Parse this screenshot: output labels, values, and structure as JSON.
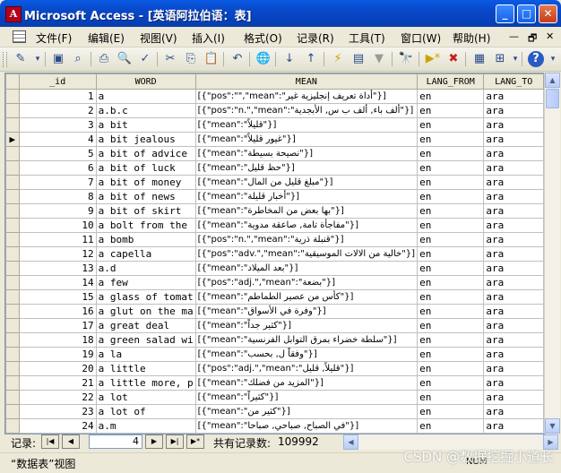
{
  "window": {
    "app_icon": "access-key-icon",
    "title": "Microsoft Access - [英语阿拉伯语：表]",
    "minimize": "_",
    "maximize": "□",
    "close": "✕"
  },
  "menu": {
    "items": [
      "文件(F)",
      "编辑(E)",
      "视图(V)",
      "插入(I)",
      "格式(O)",
      "记录(R)",
      "工具(T)",
      "窗口(W)",
      "帮助(H)"
    ],
    "mdi_min": "—",
    "mdi_restore": "🗗",
    "mdi_close": "✕"
  },
  "toolbar_icons": [
    "view-icon",
    "save-icon",
    "search-db-icon",
    "print-icon",
    "print-preview-icon",
    "spellcheck-icon",
    "cut-icon",
    "copy-icon",
    "paste-icon",
    "undo-icon",
    "hyperlink-icon",
    "sort-asc-icon",
    "sort-desc-icon",
    "filter-by-selection-icon",
    "filter-by-form-icon",
    "apply-filter-icon",
    "find-icon",
    "new-record-icon",
    "delete-record-icon",
    "database-window-icon",
    "new-object-icon",
    "help-icon"
  ],
  "table": {
    "columns": [
      "_id",
      "WORD",
      "MEAN",
      "LANG_FROM",
      "LANG_TO"
    ],
    "current_row_index": 3,
    "rows": [
      {
        "id": "1",
        "word": "a",
        "mean": "[{\"pos\":\"\",\"mean\":\"أداة تعريف إنجليزية غير\"}]",
        "from": "en",
        "to": "ara"
      },
      {
        "id": "2",
        "word": "a.b.c",
        "mean": "[{\"pos\":\"n.\",\"mean\":\"ألف باء, ألف ب س, الأبجدية\"}]",
        "from": "en",
        "to": "ara"
      },
      {
        "id": "3",
        "word": "a bit",
        "mean": "[{\"mean\":\"قليلاً\"}]",
        "from": "en",
        "to": "ara"
      },
      {
        "id": "4",
        "word": "a bit jealous",
        "mean": "[{\"mean\":\"غيور قليلاً\"}]",
        "from": "en",
        "to": "ara"
      },
      {
        "id": "5",
        "word": "a bit of advice",
        "mean": "[{\"mean\":\"نصيحة بسيطة\"}]",
        "from": "en",
        "to": "ara"
      },
      {
        "id": "6",
        "word": "a bit of luck",
        "mean": "[{\"mean\":\"حظ قليل\"}]",
        "from": "en",
        "to": "ara"
      },
      {
        "id": "7",
        "word": "a bit of money",
        "mean": "[{\"mean\":\"مبلغ قليل من المال\"}]",
        "from": "en",
        "to": "ara"
      },
      {
        "id": "8",
        "word": "a bit of news",
        "mean": "[{\"mean\":\"أخبار قليلة\"}]",
        "from": "en",
        "to": "ara"
      },
      {
        "id": "9",
        "word": "a bit of skirt",
        "mean": "[{\"mean\":\"بها بعض من المخاطرة\"}]",
        "from": "en",
        "to": "ara"
      },
      {
        "id": "10",
        "word": "a bolt from the",
        "mean": "[{\"mean\":\"مفاجأة تامة, صاعقة مدوية\"}]",
        "from": "en",
        "to": "ara"
      },
      {
        "id": "11",
        "word": "a bomb",
        "mean": "[{\"pos\":\"n.\",\"mean\":\"قنبلة ذرية\"}]",
        "from": "en",
        "to": "ara"
      },
      {
        "id": "12",
        "word": "a capella",
        "mean": "[{\"pos\":\"adv.\",\"mean\":\"خالية من الالات الموسيقية\"}]",
        "from": "en",
        "to": "ara"
      },
      {
        "id": "13",
        "word": "a.d",
        "mean": "[{\"mean\":\"بعد الميلاد\"}]",
        "from": "en",
        "to": "ara"
      },
      {
        "id": "14",
        "word": "a few",
        "mean": "[{\"pos\":\"adj.\",\"mean\":\"بضعة\"}]",
        "from": "en",
        "to": "ara"
      },
      {
        "id": "15",
        "word": "a glass of tomat",
        "mean": "[{\"mean\":\"كأس من عصير الطماطم\"}]",
        "from": "en",
        "to": "ara"
      },
      {
        "id": "16",
        "word": "a glut on the ma",
        "mean": "[{\"mean\":\"وفرة في الأسواق\"}]",
        "from": "en",
        "to": "ara"
      },
      {
        "id": "17",
        "word": "a great deal",
        "mean": "[{\"mean\":\"كثير جداً\"}]",
        "from": "en",
        "to": "ara"
      },
      {
        "id": "18",
        "word": "a green salad wi",
        "mean": "[{\"mean\":\"سلطة خضراء بمرق التوابل الفرنسية\"}]",
        "from": "en",
        "to": "ara"
      },
      {
        "id": "19",
        "word": "a la",
        "mean": "[{\"mean\":\"وفقاً ل, بحسب\"}]",
        "from": "en",
        "to": "ara"
      },
      {
        "id": "20",
        "word": "a little",
        "mean": "[{\"pos\":\"adj.\",\"mean\":\"قليلاً, قليل\"}]",
        "from": "en",
        "to": "ara"
      },
      {
        "id": "21",
        "word": "a little more, p",
        "mean": "[{\"mean\":\"المزيد من فضلك\"}]",
        "from": "en",
        "to": "ara"
      },
      {
        "id": "22",
        "word": "a lot",
        "mean": "[{\"mean\":\"كثيراً\"}]",
        "from": "en",
        "to": "ara"
      },
      {
        "id": "23",
        "word": "a lot of",
        "mean": "[{\"mean\":\"كثير من\"}]",
        "from": "en",
        "to": "ara"
      },
      {
        "id": "24",
        "word": "a.m",
        "mean": "[{\"mean\":\"في الصباح, صباحي, صباحا\"}]",
        "from": "en",
        "to": "ara"
      }
    ]
  },
  "navigator": {
    "label": "记录:",
    "current": "4",
    "total_label": "共有记录数:",
    "total": "109992"
  },
  "status": {
    "view": "“数据表”视图",
    "indicator": "NUM"
  },
  "watermark": "CSDN @数据挖掘小道长"
}
